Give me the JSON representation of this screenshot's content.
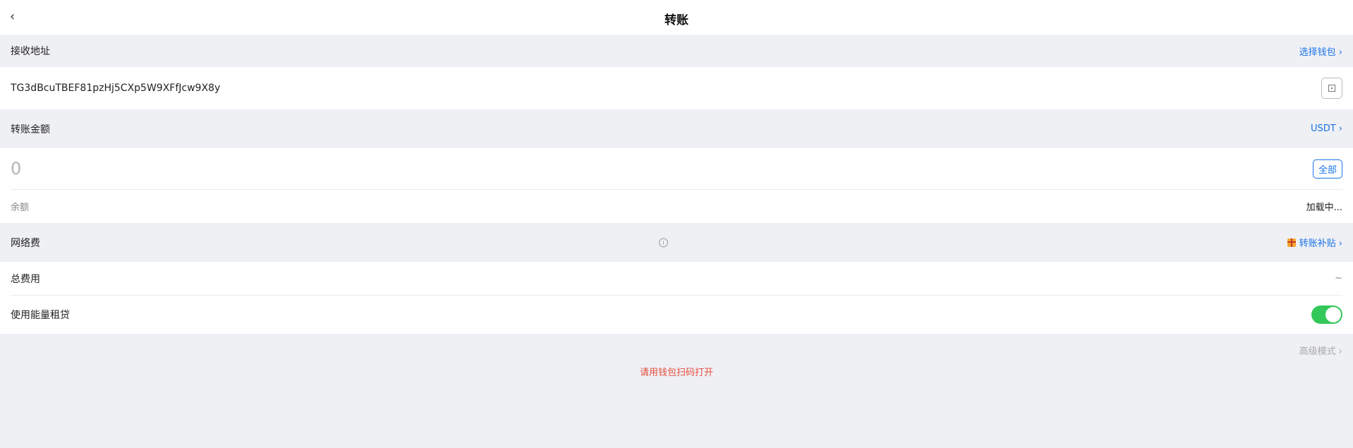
{
  "header": {
    "back_label": "‹",
    "title": "转账"
  },
  "recipient": {
    "label": "接收地址",
    "select_wallet": "选择钱包 ›",
    "address": "TG3dBcuTBEF81pzHj5CXp5W9XFfJcw9X8y",
    "scan_icon": "scan-icon"
  },
  "amount": {
    "label": "转账金额",
    "token": "USDT ›",
    "placeholder": "0",
    "all_button": "全部",
    "balance_label": "余额",
    "balance_value": "加载中..."
  },
  "fee": {
    "label": "网络费",
    "info_icon": "info-icon",
    "subsidy_icon": "gift-icon",
    "subsidy_link": "转账补贴 ›",
    "total_label": "总费用",
    "total_value": "~",
    "energy_label": "使用能量租贷",
    "energy_enabled": true
  },
  "footer": {
    "advanced_mode": "高级模式 ›",
    "scan_hint": "请用钱包扫码打开"
  },
  "colors": {
    "accent": "#1a73e8",
    "toggle_on": "#34c759",
    "hint_red": "#e74c3c",
    "background": "#eff0f4"
  }
}
